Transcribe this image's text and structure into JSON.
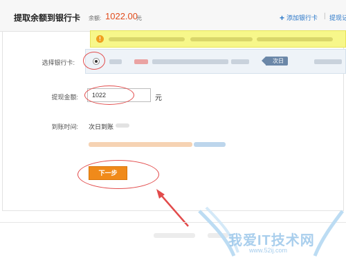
{
  "header": {
    "title": "提取余额到银行卡",
    "balance_label": "余额:",
    "balance_value": "1022.00",
    "balance_unit": "元",
    "add_card_label": "添加银行卡",
    "separator": "|",
    "record_label": "提现记"
  },
  "form": {
    "card_label": "选择银行卡:",
    "card_tag": "次日",
    "amount_label": "提现金额:",
    "amount_value": "1022",
    "amount_unit": "元",
    "arrival_label": "到账时间:",
    "arrival_value": "次日到账",
    "next_button": "下一步"
  },
  "watermark": {
    "text": "我爱IT技术网",
    "url": "www.52ij.com"
  },
  "colors": {
    "accent_orange": "#f08a1a",
    "balance_red": "#e14b1b",
    "link_blue": "#2a77c9",
    "annotation_red": "#e24b4b",
    "notice_yellow": "#f7f78a"
  },
  "icons": {
    "add": "plus-icon",
    "warning": "warning-icon",
    "radio": "radio-selected",
    "annotation_arrow": "arrow-icon"
  }
}
